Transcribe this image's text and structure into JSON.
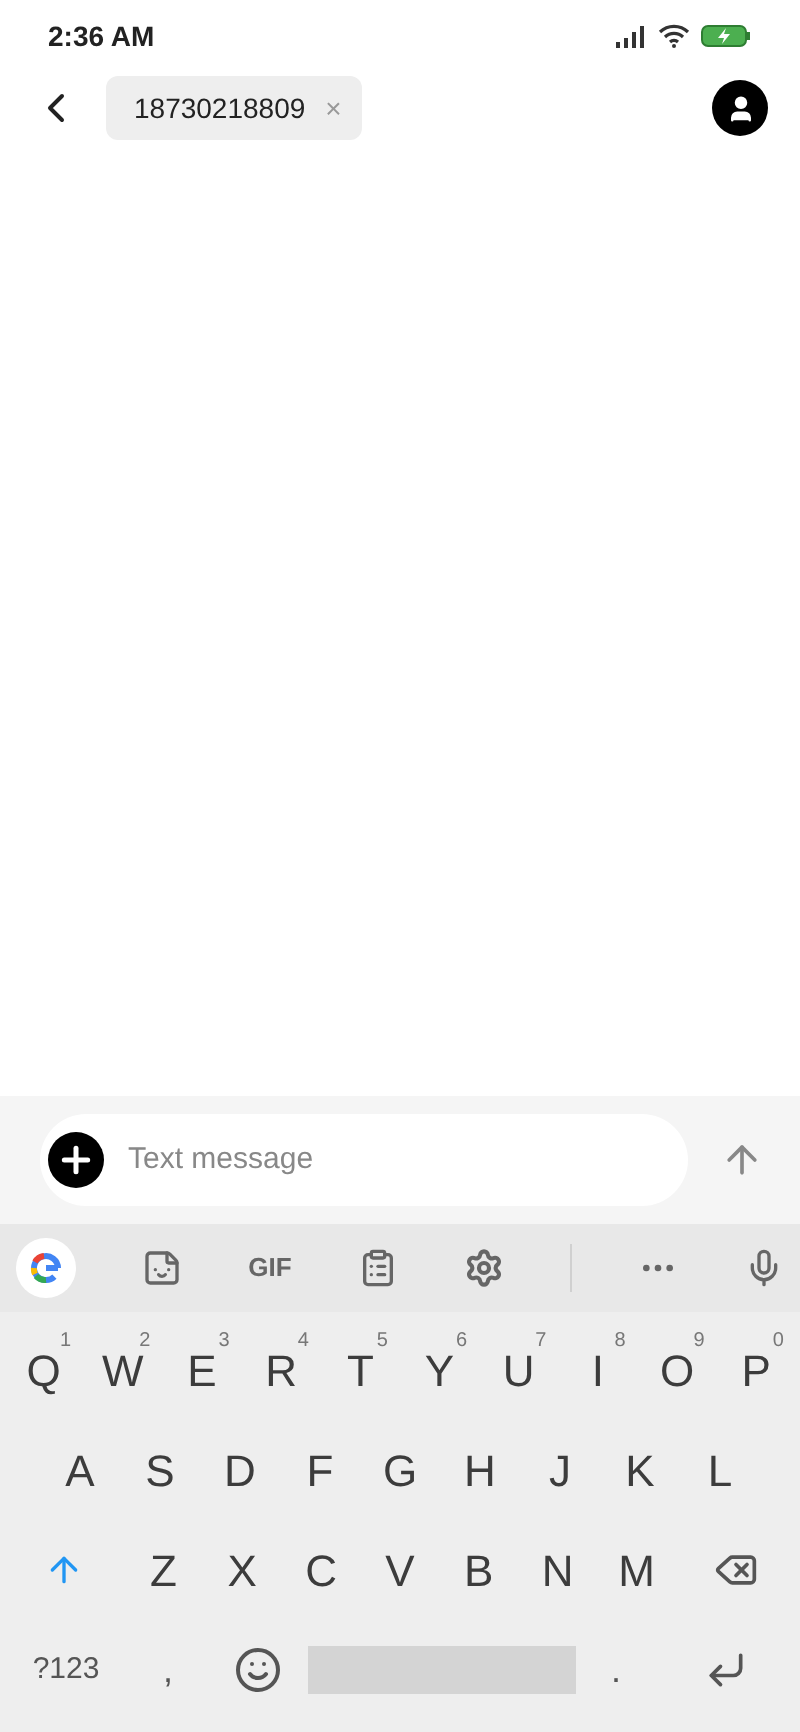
{
  "status_bar": {
    "time": "2:36 AM"
  },
  "header": {
    "recipient": "18730218809",
    "remove": "×"
  },
  "composer": {
    "placeholder": "Text message"
  },
  "keyboard_toolbar": {
    "gif": "GIF"
  },
  "keyboard": {
    "rows": [
      [
        {
          "kind": "letter",
          "label": "Q",
          "hint": "1"
        },
        {
          "kind": "letter",
          "label": "W",
          "hint": "2"
        },
        {
          "kind": "letter",
          "label": "E",
          "hint": "3"
        },
        {
          "kind": "letter",
          "label": "R",
          "hint": "4"
        },
        {
          "kind": "letter",
          "label": "T",
          "hint": "5"
        },
        {
          "kind": "letter",
          "label": "Y",
          "hint": "6"
        },
        {
          "kind": "letter",
          "label": "U",
          "hint": "7"
        },
        {
          "kind": "letter",
          "label": "I",
          "hint": "8"
        },
        {
          "kind": "letter",
          "label": "O",
          "hint": "9"
        },
        {
          "kind": "letter",
          "label": "P",
          "hint": "0"
        }
      ],
      [
        {
          "kind": "letter",
          "label": "A"
        },
        {
          "kind": "letter",
          "label": "S"
        },
        {
          "kind": "letter",
          "label": "D"
        },
        {
          "kind": "letter",
          "label": "F"
        },
        {
          "kind": "letter",
          "label": "G"
        },
        {
          "kind": "letter",
          "label": "H"
        },
        {
          "kind": "letter",
          "label": "J"
        },
        {
          "kind": "letter",
          "label": "K"
        },
        {
          "kind": "letter",
          "label": "L"
        }
      ],
      [
        {
          "kind": "shift",
          "on": true
        },
        {
          "kind": "letter",
          "label": "Z"
        },
        {
          "kind": "letter",
          "label": "X"
        },
        {
          "kind": "letter",
          "label": "C"
        },
        {
          "kind": "letter",
          "label": "V"
        },
        {
          "kind": "letter",
          "label": "B"
        },
        {
          "kind": "letter",
          "label": "N"
        },
        {
          "kind": "letter",
          "label": "M"
        },
        {
          "kind": "backspace"
        }
      ],
      [
        {
          "kind": "symbols",
          "label": "?123"
        },
        {
          "kind": "comma",
          "label": ","
        },
        {
          "kind": "emoji"
        },
        {
          "kind": "space"
        },
        {
          "kind": "period",
          "label": "."
        },
        {
          "kind": "enter"
        }
      ]
    ]
  }
}
